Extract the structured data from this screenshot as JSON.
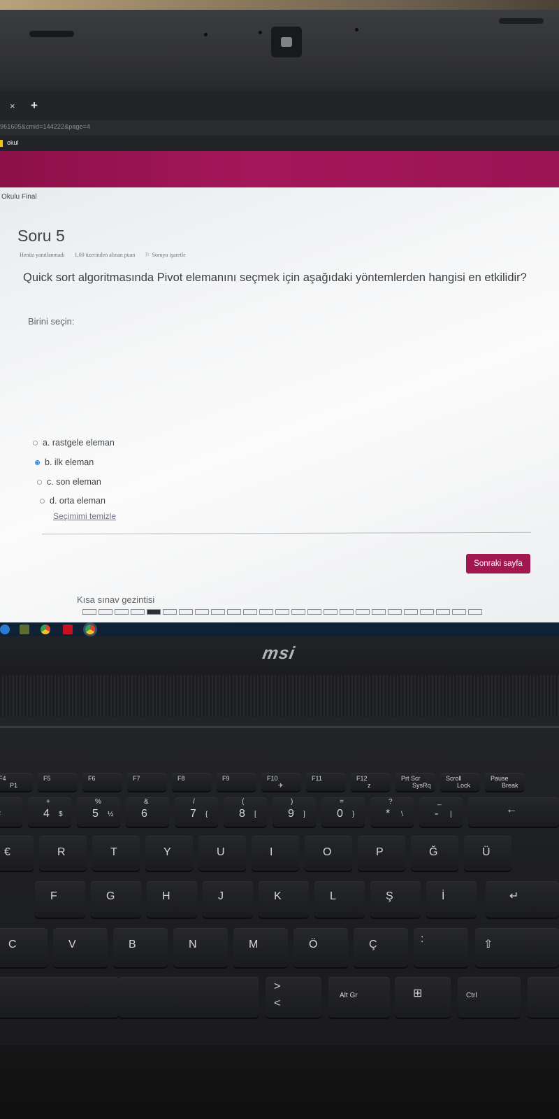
{
  "browser": {
    "tab_close": "×",
    "new_tab": "+",
    "url": "961605&cmid=144222&page=4",
    "bookmark": "okul"
  },
  "page": {
    "breadcrumb": "Okulu Final",
    "question_title": "Soru 5",
    "meta": {
      "status": "Henüz yanıtlanmadı",
      "points": "1,00 üzerinden alınan puan",
      "flag": "Soruyu işaretle"
    },
    "question_text": "Quick sort algoritmasında Pivot elemanını seçmek için aşağıdaki yöntemlerden hangisi en etkilidir?",
    "choose_label": "Birini seçin:",
    "options": [
      {
        "label": "a. rastgele eleman",
        "selected": false
      },
      {
        "label": "b. ilk eleman",
        "selected": true
      },
      {
        "label": "c. son eleman",
        "selected": false
      },
      {
        "label": "d. orta eleman",
        "selected": false
      }
    ],
    "clear_choice": "Seçimimi temizle",
    "next_button": "Sonraki sayfa",
    "nav_title": "Kısa sınav gezintisi",
    "nav_current_question": 5,
    "accent_color": "#a2174f"
  },
  "laptop": {
    "brand": "msi"
  },
  "keyboard": {
    "fn_row": [
      {
        "main": "F4",
        "sub": "P1"
      },
      {
        "main": "F5",
        "sub": ""
      },
      {
        "main": "F6",
        "sub": ""
      },
      {
        "main": "F7",
        "sub": ""
      },
      {
        "main": "F8",
        "sub": ""
      },
      {
        "main": "F9",
        "sub": ""
      },
      {
        "main": "F10",
        "sub": "✈"
      },
      {
        "main": "F11",
        "sub": ""
      },
      {
        "main": "F12",
        "sub": "z"
      },
      {
        "main": "Prt Scr",
        "sub": "SysRq"
      },
      {
        "main": "Scroll",
        "sub": "Lock"
      },
      {
        "main": "Pause",
        "sub": "Break"
      }
    ],
    "num_row": [
      {
        "top": "",
        "main": "#"
      },
      {
        "top": "+",
        "main": "4",
        "alt": "$"
      },
      {
        "top": "%",
        "main": "5",
        "alt": "½"
      },
      {
        "top": "&",
        "main": "6"
      },
      {
        "top": "/",
        "main": "7",
        "alt": "{"
      },
      {
        "top": "(",
        "main": "8",
        "alt": "["
      },
      {
        "top": ")",
        "main": "9",
        "alt": "]"
      },
      {
        "top": "=",
        "main": "0",
        "alt": "}"
      },
      {
        "top": "?",
        "main": "*",
        "alt": "\\"
      },
      {
        "top": "_",
        "main": "-",
        "alt": "|"
      }
    ],
    "row_q": [
      "€",
      "R",
      "T",
      "Y",
      "U",
      "I",
      "O",
      "P",
      "Ğ",
      "Ü"
    ],
    "row_a": [
      "F",
      "G",
      "H",
      "J",
      "K",
      "L",
      "Ş",
      "İ"
    ],
    "row_z": [
      "C",
      "V",
      "B",
      "N",
      "M",
      "Ö",
      "Ç"
    ],
    "bottom": {
      "altgr": "Alt Gr",
      "ctrl": "Ctrl",
      "lt": "<",
      "gt": ">"
    }
  }
}
